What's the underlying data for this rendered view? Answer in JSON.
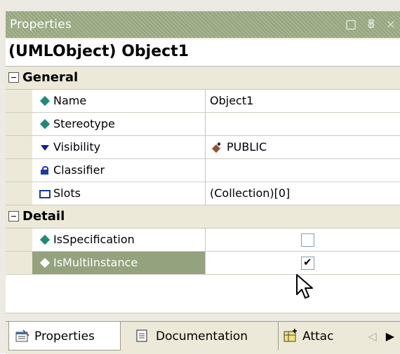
{
  "panel": {
    "title": "Properties",
    "window_buttons": [
      "□",
      "ꟷ",
      "×"
    ]
  },
  "object_header": "(UMLObject) Object1",
  "categories": [
    {
      "label": "General",
      "rows": [
        {
          "name": "Name",
          "value": "Object1",
          "icon": "diamond-icon"
        },
        {
          "name": "Stereotype",
          "value": "",
          "icon": "diamond-icon"
        },
        {
          "name": "Visibility",
          "value": "PUBLIC",
          "icon": "triangle-down-icon"
        },
        {
          "name": "Classifier",
          "value": "",
          "icon": "lock-icon"
        },
        {
          "name": "Slots",
          "value": "(Collection)[0]",
          "icon": "slot-icon"
        }
      ]
    },
    {
      "label": "Detail",
      "rows": [
        {
          "name": "IsSpecification",
          "checked": false,
          "icon": "diamond-icon"
        },
        {
          "name": "IsMultiInstance",
          "checked": true,
          "icon": "diamond-icon",
          "selected": true
        }
      ]
    }
  ],
  "tabs": [
    {
      "label": "Properties",
      "active": true
    },
    {
      "label": "Documentation",
      "active": false
    },
    {
      "label": "Attac",
      "active": false
    }
  ],
  "colors": {
    "titlebar": "#9cac84",
    "selection": "#94a27d",
    "icon_teal": "#1f8a78",
    "icon_blue": "#1a3aa8"
  }
}
